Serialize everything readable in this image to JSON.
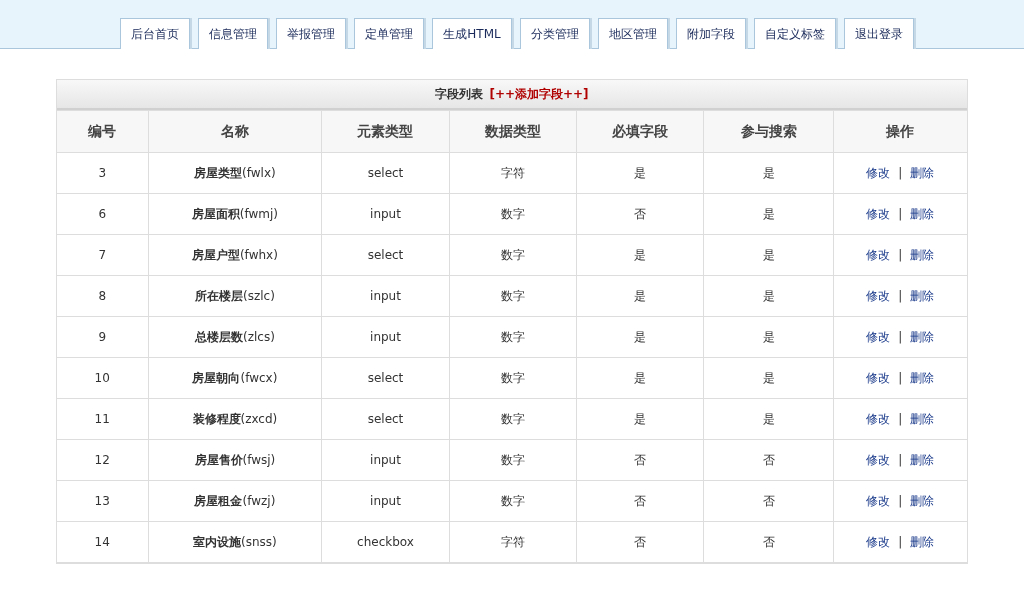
{
  "tabs": [
    {
      "label": "后台首页"
    },
    {
      "label": "信息管理"
    },
    {
      "label": "举报管理"
    },
    {
      "label": "定单管理"
    },
    {
      "label": "生成HTML"
    },
    {
      "label": "分类管理"
    },
    {
      "label": "地区管理"
    },
    {
      "label": "附加字段"
    },
    {
      "label": "自定义标签"
    },
    {
      "label": "退出登录"
    }
  ],
  "panel": {
    "title": "字段列表",
    "add_link": "[++添加字段++]"
  },
  "table": {
    "columns": [
      "编号",
      "名称",
      "元素类型",
      "数据类型",
      "必填字段",
      "参与搜索",
      "操作"
    ],
    "rows": [
      {
        "id": "3",
        "name": "**房屋类型**(fwlx)",
        "element": "select",
        "data_type": "字符",
        "required": "是",
        "searchable": "是",
        "edit": "修改",
        "sep": "|",
        "delete": "删除"
      },
      {
        "id": "6",
        "name": "**房屋面积**(fwmj)",
        "element": "input",
        "data_type": "数字",
        "required": "否",
        "searchable": "是",
        "edit": "修改",
        "sep": "|",
        "delete": "删除"
      },
      {
        "id": "7",
        "name": "**房屋户型**(fwhx)",
        "element": "select",
        "data_type": "数字",
        "required": "是",
        "searchable": "是",
        "edit": "修改",
        "sep": "|",
        "delete": "删除"
      },
      {
        "id": "8",
        "name": "**所在楼层**(szlc)",
        "element": "input",
        "data_type": "数字",
        "required": "是",
        "searchable": "是",
        "edit": "修改",
        "sep": "|",
        "delete": "删除"
      },
      {
        "id": "9",
        "name": "**总楼层数**(zlcs)",
        "element": "input",
        "data_type": "数字",
        "required": "是",
        "searchable": "是",
        "edit": "修改",
        "sep": "|",
        "delete": "删除"
      },
      {
        "id": "10",
        "name": "**房屋朝向**(fwcx)",
        "element": "select",
        "data_type": "数字",
        "required": "是",
        "searchable": "是",
        "edit": "修改",
        "sep": "|",
        "delete": "删除"
      },
      {
        "id": "11",
        "name": "**装修程度**(zxcd)",
        "element": "select",
        "data_type": "数字",
        "required": "是",
        "searchable": "是",
        "edit": "修改",
        "sep": "|",
        "delete": "删除"
      },
      {
        "id": "12",
        "name": "**房屋售价**(fwsj)",
        "element": "input",
        "data_type": "数字",
        "required": "否",
        "searchable": "否",
        "edit": "修改",
        "sep": "|",
        "delete": "删除"
      },
      {
        "id": "13",
        "name": "**房屋租金**(fwzj)",
        "element": "input",
        "data_type": "数字",
        "required": "否",
        "searchable": "否",
        "edit": "修改",
        "sep": "|",
        "delete": "删除"
      },
      {
        "id": "14",
        "name": "**室内设施**(snss)",
        "element": "checkbox",
        "data_type": "字符",
        "required": "否",
        "searchable": "否",
        "edit": "修改",
        "sep": "|",
        "delete": "删除"
      }
    ]
  }
}
